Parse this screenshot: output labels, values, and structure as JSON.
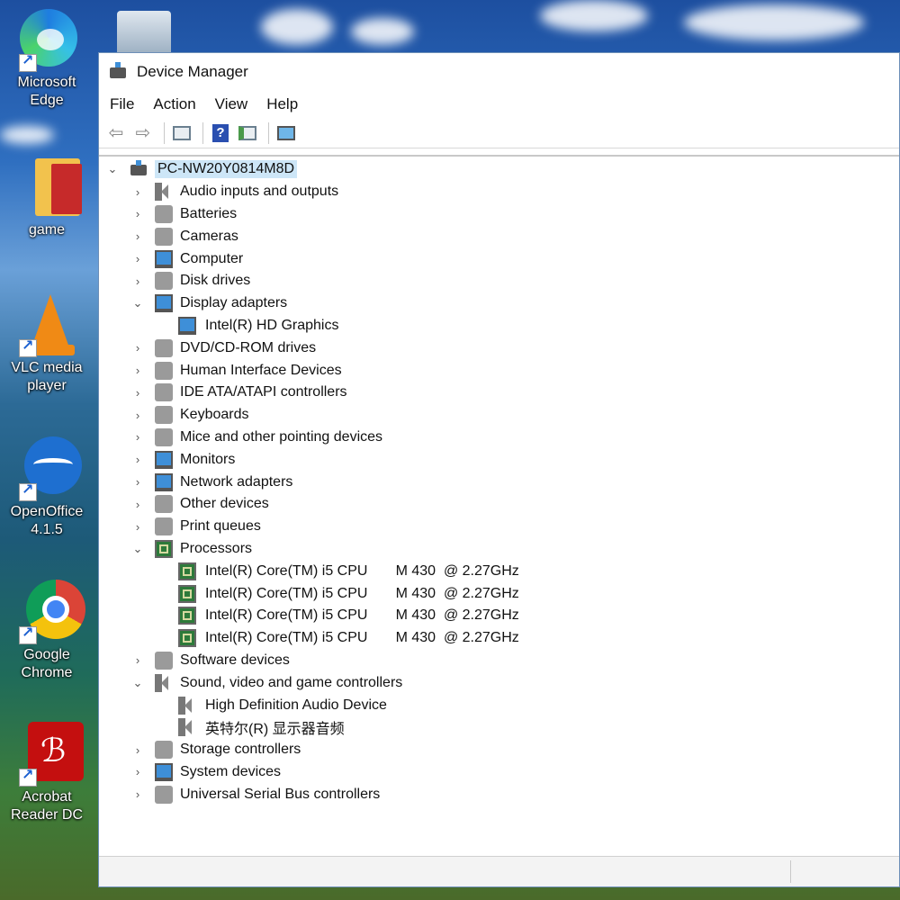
{
  "desktop": {
    "icons": [
      {
        "label_1": "Microsoft",
        "label_2": "Edge",
        "icon": "edge-icon"
      },
      {
        "label_1": "game",
        "label_2": "",
        "icon": "folder-icon"
      },
      {
        "label_1": "VLC media",
        "label_2": "player",
        "icon": "vlc-icon"
      },
      {
        "label_1": "OpenOffice",
        "label_2": "4.1.5",
        "icon": "openoffice-icon"
      },
      {
        "label_1": "Google",
        "label_2": "Chrome",
        "icon": "chrome-icon"
      },
      {
        "label_1": "Acrobat",
        "label_2": "Reader DC",
        "icon": "acrobat-icon"
      }
    ]
  },
  "window": {
    "title": "Device Manager",
    "menu": [
      "File",
      "Action",
      "View",
      "Help"
    ],
    "toolbar": [
      "back-icon",
      "forward-icon",
      "properties-icon",
      "help-icon",
      "update-driver-icon",
      "scan-hardware-icon"
    ]
  },
  "tree": {
    "root": "PC-NW20Y0814M8D",
    "items": [
      {
        "label": "Audio inputs and outputs",
        "expanded": false,
        "icon": "speaker-icon"
      },
      {
        "label": "Batteries",
        "expanded": false,
        "icon": "battery-icon"
      },
      {
        "label": "Cameras",
        "expanded": false,
        "icon": "camera-icon"
      },
      {
        "label": "Computer",
        "expanded": false,
        "icon": "computer-icon"
      },
      {
        "label": "Disk drives",
        "expanded": false,
        "icon": "disk-drive-icon"
      },
      {
        "label": "Display adapters",
        "expanded": true,
        "icon": "display-adapter-icon",
        "children": [
          "Intel(R) HD Graphics"
        ]
      },
      {
        "label": "DVD/CD-ROM drives",
        "expanded": false,
        "icon": "dvd-icon"
      },
      {
        "label": "Human Interface Devices",
        "expanded": false,
        "icon": "hid-icon"
      },
      {
        "label": "IDE ATA/ATAPI controllers",
        "expanded": false,
        "icon": "ide-controller-icon"
      },
      {
        "label": "Keyboards",
        "expanded": false,
        "icon": "keyboard-icon"
      },
      {
        "label": "Mice and other pointing devices",
        "expanded": false,
        "icon": "mouse-icon"
      },
      {
        "label": "Monitors",
        "expanded": false,
        "icon": "monitor-icon"
      },
      {
        "label": "Network adapters",
        "expanded": false,
        "icon": "network-adapter-icon"
      },
      {
        "label": "Other devices",
        "expanded": false,
        "icon": "other-devices-icon"
      },
      {
        "label": "Print queues",
        "expanded": false,
        "icon": "printer-icon"
      },
      {
        "label": "Processors",
        "expanded": true,
        "icon": "processor-icon",
        "children": [
          "Intel(R) Core(TM) i5 CPU       M 430  @ 2.27GHz",
          "Intel(R) Core(TM) i5 CPU       M 430  @ 2.27GHz",
          "Intel(R) Core(TM) i5 CPU       M 430  @ 2.27GHz",
          "Intel(R) Core(TM) i5 CPU       M 430  @ 2.27GHz"
        ]
      },
      {
        "label": "Software devices",
        "expanded": false,
        "icon": "software-device-icon"
      },
      {
        "label": "Sound, video and game controllers",
        "expanded": true,
        "icon": "speaker-icon",
        "children": [
          "High Definition Audio Device",
          "英特尔(R) 显示器音频"
        ]
      },
      {
        "label": "Storage controllers",
        "expanded": false,
        "icon": "storage-controller-icon"
      },
      {
        "label": "System devices",
        "expanded": false,
        "icon": "system-device-icon"
      },
      {
        "label": "Universal Serial Bus controllers",
        "expanded": false,
        "icon": "usb-icon"
      }
    ]
  }
}
